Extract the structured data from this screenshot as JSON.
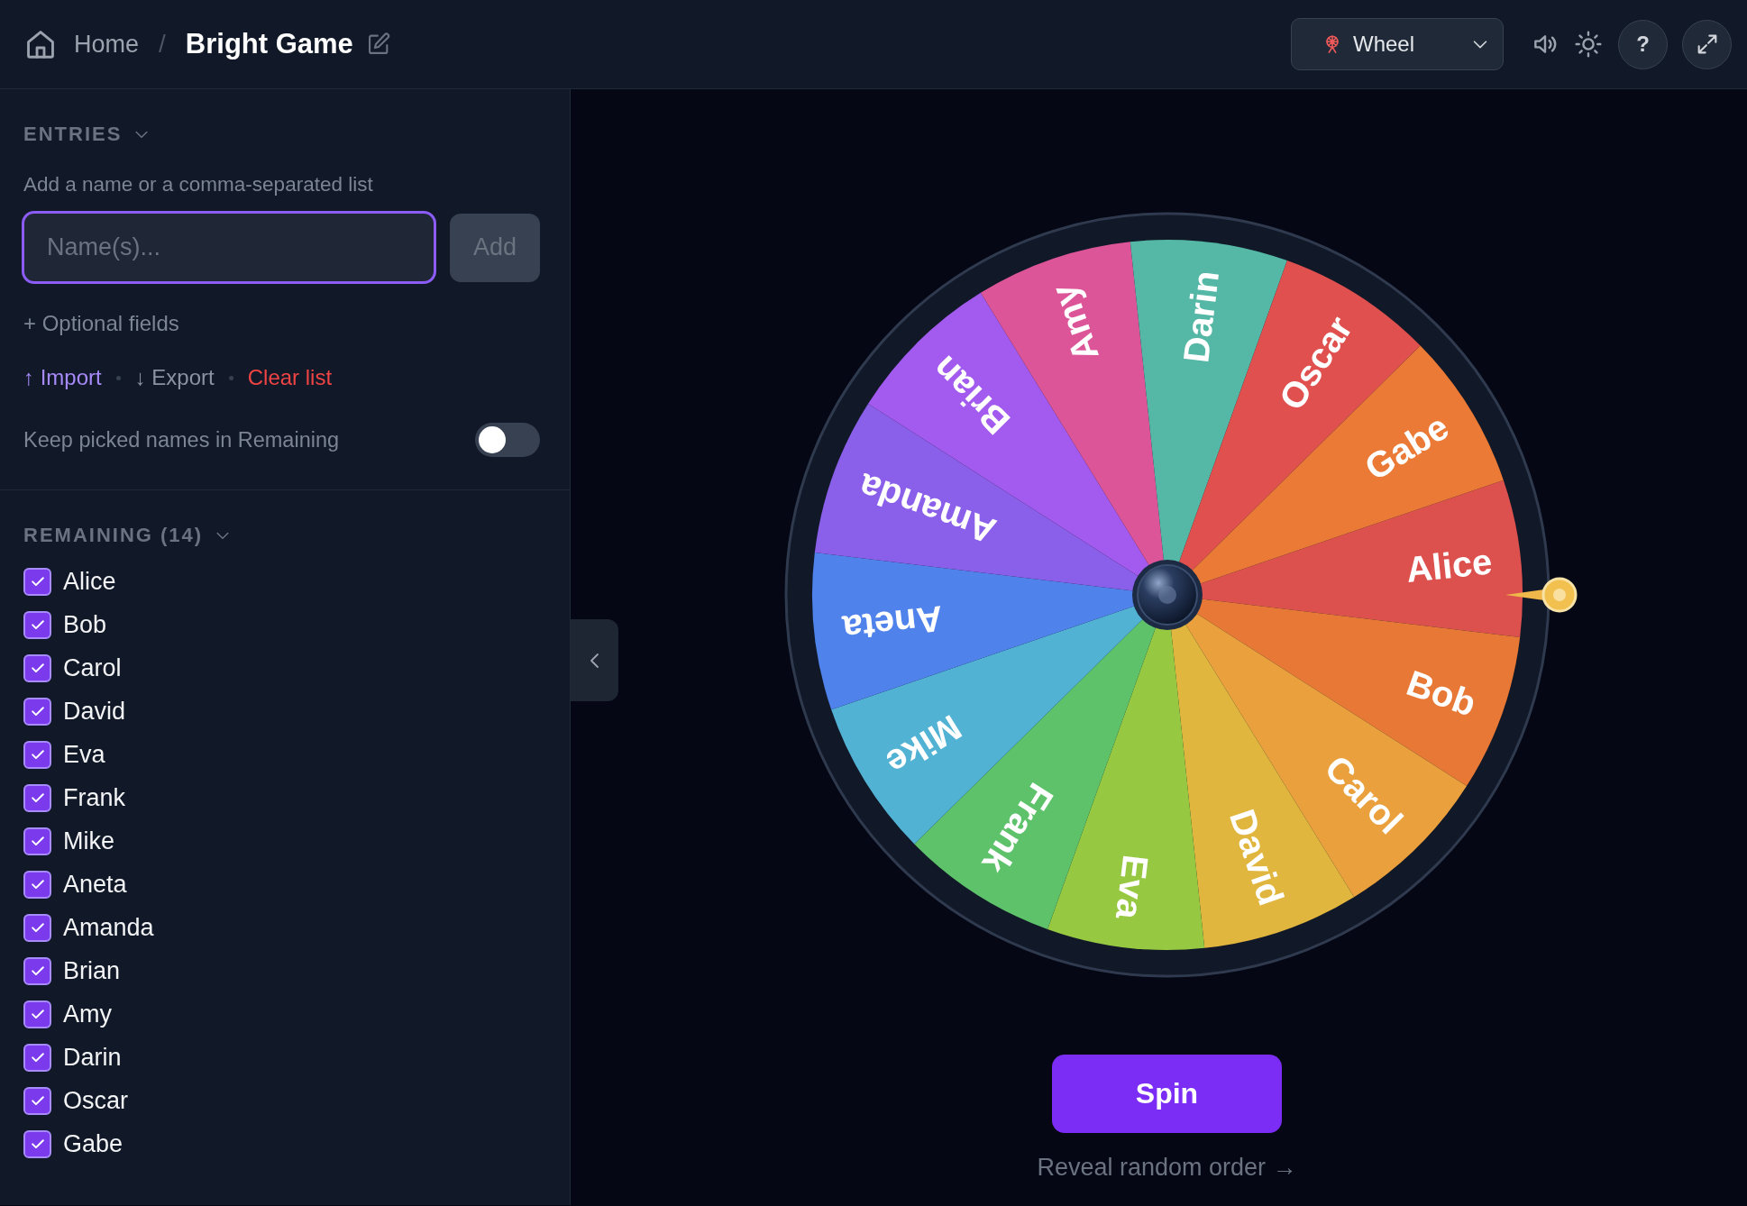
{
  "header": {
    "home_label": "Home",
    "separator": "/",
    "title": "Bright Game",
    "mode_select": {
      "value": "Wheel"
    },
    "help_label": "?"
  },
  "entries": {
    "heading": "ENTRIES",
    "hint": "Add a name or a comma-separated list",
    "input": {
      "placeholder": "Name(s)..."
    },
    "add_button": "Add",
    "optional_fields": "+ Optional fields",
    "actions": [
      {
        "label": "↑ Import",
        "kind": "import"
      },
      {
        "label": "↓ Export",
        "kind": "export"
      },
      {
        "label": "Clear list",
        "kind": "clear"
      }
    ],
    "keep_picked": {
      "label": "Keep picked names in Remaining",
      "on": false
    }
  },
  "remaining": {
    "heading": "REMAINING (14)",
    "items": [
      {
        "label": "Alice",
        "checked": true
      },
      {
        "label": "Bob",
        "checked": true
      },
      {
        "label": "Carol",
        "checked": true
      },
      {
        "label": "David",
        "checked": true
      },
      {
        "label": "Eva",
        "checked": true
      },
      {
        "label": "Frank",
        "checked": true
      },
      {
        "label": "Mike",
        "checked": true
      },
      {
        "label": "Aneta",
        "checked": true
      },
      {
        "label": "Amanda",
        "checked": true
      },
      {
        "label": "Brian",
        "checked": true
      },
      {
        "label": "Amy",
        "checked": true
      },
      {
        "label": "Darin",
        "checked": true
      },
      {
        "label": "Oscar",
        "checked": true
      },
      {
        "label": "Gabe",
        "checked": true
      }
    ]
  },
  "wheel": {
    "segments": [
      {
        "label": "Alice",
        "color": "#dc504d"
      },
      {
        "label": "Bob",
        "color": "#e87836"
      },
      {
        "label": "Carol",
        "color": "#e9a03d"
      },
      {
        "label": "David",
        "color": "#e1b63f"
      },
      {
        "label": "Eva",
        "color": "#97c842"
      },
      {
        "label": "Frank",
        "color": "#5dc26a"
      },
      {
        "label": "Mike",
        "color": "#52b2d3"
      },
      {
        "label": "Aneta",
        "color": "#4f82ea"
      },
      {
        "label": "Amanda",
        "color": "#8a5fe9"
      },
      {
        "label": "Brian",
        "color": "#a25aef"
      },
      {
        "label": "Amy",
        "color": "#dd5599"
      },
      {
        "label": "Darin",
        "color": "#55b7a5"
      },
      {
        "label": "Oscar",
        "color": "#df504e"
      },
      {
        "label": "Gabe",
        "color": "#ea7a36"
      }
    ]
  },
  "spin_button": "Spin",
  "reveal_link": "Reveal random order →"
}
